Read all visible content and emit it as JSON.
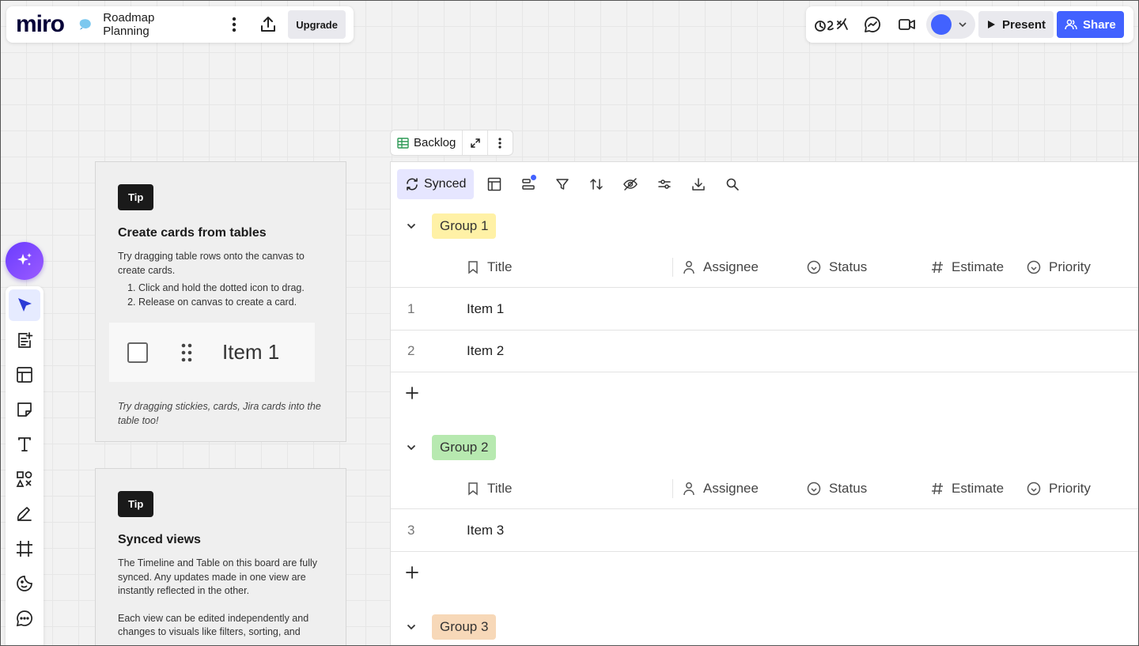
{
  "header": {
    "logo": "miro",
    "board_name": "Roadmap Planning",
    "upgrade_label": "Upgrade",
    "present_label": "Present",
    "share_label": "Share",
    "colors": {
      "brand": "#4262ff",
      "ai": "#7a4dff"
    }
  },
  "left_toolbar": {
    "tools": [
      "select-tool",
      "templates",
      "frames-table",
      "sticky-note",
      "text",
      "shapes",
      "pen",
      "frame",
      "stickers",
      "comment"
    ]
  },
  "tips": [
    {
      "badge": "Tip",
      "title": "Create cards from tables",
      "body": "Try dragging table rows onto the canvas to create cards.",
      "steps": [
        "Click and hold the dotted icon to drag.",
        "Release on canvas to create a card."
      ],
      "demo_item": "Item 1",
      "footer": "Try dragging stickies, cards, Jira cards into the table too!"
    },
    {
      "badge": "Tip",
      "title": "Synced views",
      "body": "The Timeline and Table on this board are fully synced. Any updates made in one view are instantly reflected in the other.",
      "body2": "Each view can be edited independently and changes to visuals like filters, sorting, and"
    }
  ],
  "table": {
    "tab_label": "Backlog",
    "synced_label": "Synced",
    "columns": [
      "Title",
      "Assignee",
      "Status",
      "Estimate",
      "Priority"
    ],
    "groups": [
      {
        "name": "Group 1",
        "color": "#fff1a6",
        "rows": [
          {
            "num": "1",
            "title": "Item 1"
          },
          {
            "num": "2",
            "title": "Item 2"
          }
        ]
      },
      {
        "name": "Group 2",
        "color": "#b7e9b0",
        "rows": [
          {
            "num": "3",
            "title": "Item 3"
          }
        ]
      },
      {
        "name": "Group 3",
        "color": "#f7d8b8",
        "rows": []
      }
    ]
  }
}
